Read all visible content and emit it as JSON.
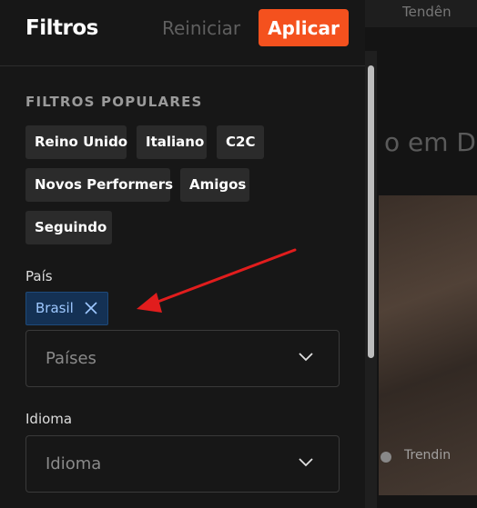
{
  "header": {
    "title": "Filtros",
    "reset_label": "Reiniciar",
    "apply_label": "Aplicar",
    "accent_color": "#f4511e"
  },
  "popular": {
    "title": "FILTROS POPULARES",
    "chips": [
      "Reino Unido",
      "Italiano",
      "C2C",
      "Novos Performers",
      "Amigos",
      "Seguindo"
    ]
  },
  "country": {
    "label": "País",
    "selected": "Brasil",
    "placeholder": "Países"
  },
  "language": {
    "label": "Idioma",
    "placeholder": "Idioma"
  },
  "background": {
    "topbar_text": "Tendên",
    "heading": "o em Di",
    "thumb_label": "Trendin"
  },
  "annotation": {
    "arrow_color": "#e11d1d"
  }
}
